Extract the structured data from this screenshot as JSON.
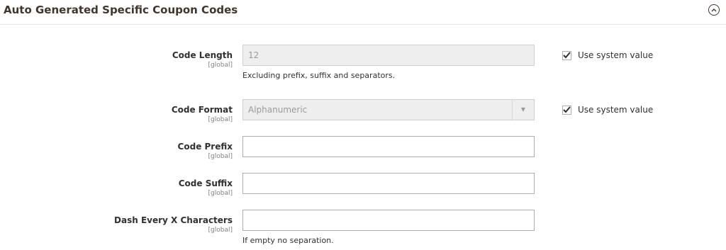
{
  "section": {
    "title": "Auto Generated Specific Coupon Codes"
  },
  "fields": {
    "code_length": {
      "label": "Code Length",
      "scope": "[global]",
      "value": "12",
      "note": "Excluding prefix, suffix and separators.",
      "use_system_value": true,
      "use_system_label": "Use system value"
    },
    "code_format": {
      "label": "Code Format",
      "scope": "[global]",
      "value": "Alphanumeric",
      "use_system_value": true,
      "use_system_label": "Use system value"
    },
    "code_prefix": {
      "label": "Code Prefix",
      "scope": "[global]",
      "value": ""
    },
    "code_suffix": {
      "label": "Code Suffix",
      "scope": "[global]",
      "value": ""
    },
    "dash_every": {
      "label": "Dash Every X Characters",
      "scope": "[global]",
      "value": "",
      "note": "If empty no separation."
    }
  },
  "icons": {
    "collapse": "chevron-up-circle-icon",
    "select_arrow": "triangle-down-icon",
    "check": "checkmark-icon"
  }
}
